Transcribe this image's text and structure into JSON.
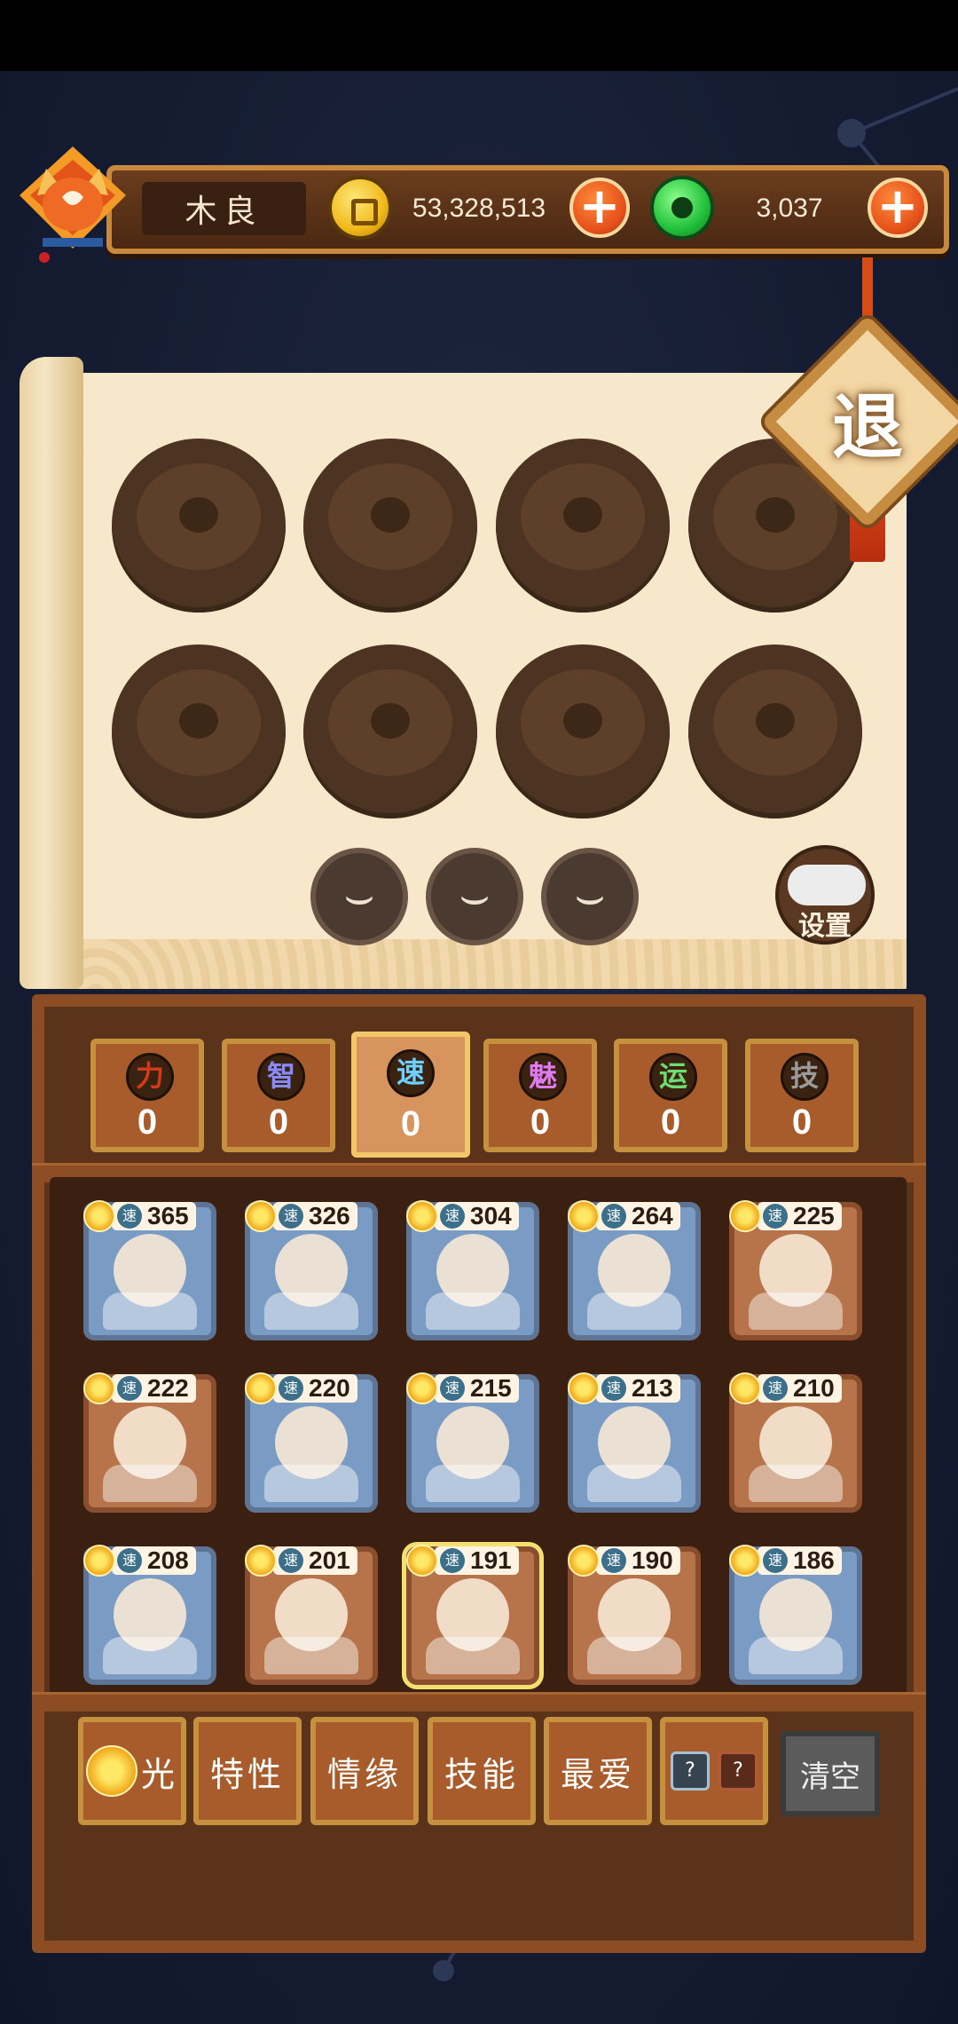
{
  "player": {
    "name": "木良"
  },
  "currencies": {
    "coins": "53,328,513",
    "jade": "3,037"
  },
  "panel": {
    "exit_label": "退",
    "settings_label": "设置"
  },
  "stats": [
    {
      "key": "power",
      "label": "力",
      "value": "0",
      "color": "#d33a1a"
    },
    {
      "key": "intellect",
      "label": "智",
      "value": "0",
      "color": "#6a6ad8"
    },
    {
      "key": "speed",
      "label": "速",
      "value": "0",
      "color": "#3c8fb0",
      "active": true
    },
    {
      "key": "charm",
      "label": "魅",
      "value": "0",
      "color": "#c04ad0"
    },
    {
      "key": "luck",
      "label": "运",
      "value": "0",
      "color": "#3ea24a"
    },
    {
      "key": "skill",
      "label": "技",
      "value": "0",
      "color": "#555555"
    }
  ],
  "speed_tag": "速",
  "cards": [
    {
      "speed": "365",
      "frame": "blue"
    },
    {
      "speed": "326",
      "frame": "blue"
    },
    {
      "speed": "304",
      "frame": "blue"
    },
    {
      "speed": "264",
      "frame": "blue"
    },
    {
      "speed": "225",
      "frame": "brown"
    },
    {
      "speed": "222",
      "frame": "brown"
    },
    {
      "speed": "220",
      "frame": "blue"
    },
    {
      "speed": "215",
      "frame": "blue"
    },
    {
      "speed": "213",
      "frame": "blue"
    },
    {
      "speed": "210",
      "frame": "brown"
    },
    {
      "speed": "208",
      "frame": "blue"
    },
    {
      "speed": "201",
      "frame": "brown"
    },
    {
      "speed": "191",
      "frame": "brown",
      "selected": true
    },
    {
      "speed": "190",
      "frame": "brown"
    },
    {
      "speed": "186",
      "frame": "blue"
    }
  ],
  "filters": {
    "light": "光",
    "trait": "特性",
    "bond": "情缘",
    "skill": "技能",
    "favorite": "最爱",
    "unknown": "?",
    "clear": "清空"
  }
}
